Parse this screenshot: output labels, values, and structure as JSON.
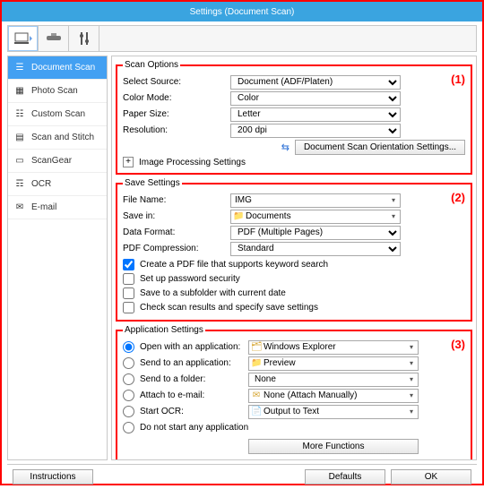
{
  "window": {
    "title": "Settings (Document Scan)"
  },
  "sidebar": {
    "items": [
      {
        "label": "Document Scan"
      },
      {
        "label": "Photo Scan"
      },
      {
        "label": "Custom Scan"
      },
      {
        "label": "Scan and Stitch"
      },
      {
        "label": "ScanGear"
      },
      {
        "label": "OCR"
      },
      {
        "label": "E-mail"
      }
    ]
  },
  "section1": {
    "badge": "(1)",
    "legend": "Scan Options",
    "select_source_label": "Select Source:",
    "select_source_value": "Document (ADF/Platen)",
    "color_mode_label": "Color Mode:",
    "color_mode_value": "Color",
    "paper_size_label": "Paper Size:",
    "paper_size_value": "Letter",
    "resolution_label": "Resolution:",
    "resolution_value": "200 dpi",
    "orient_btn": "Document Scan Orientation Settings...",
    "image_proc": "Image Processing Settings"
  },
  "section2": {
    "badge": "(2)",
    "legend": "Save Settings",
    "file_name_label": "File Name:",
    "file_name_value": "IMG",
    "save_in_label": "Save in:",
    "save_in_value": "Documents",
    "data_format_label": "Data Format:",
    "data_format_value": "PDF (Multiple Pages)",
    "pdf_comp_label": "PDF Compression:",
    "pdf_comp_value": "Standard",
    "chk1": "Create a PDF file that supports keyword search",
    "chk2": "Set up password security",
    "chk3": "Save to a subfolder with current date",
    "chk4": "Check scan results and specify save settings"
  },
  "section3": {
    "badge": "(3)",
    "legend": "Application Settings",
    "r1": "Open with an application:",
    "r1v": "Windows Explorer",
    "r2": "Send to an application:",
    "r2v": "Preview",
    "r3": "Send to a folder:",
    "r3v": "None",
    "r4": "Attach to e-mail:",
    "r4v": "None (Attach Manually)",
    "r5": "Start OCR:",
    "r5v": "Output to Text",
    "r6": "Do not start any application",
    "more": "More Functions"
  },
  "bottom": {
    "instructions": "Instructions",
    "defaults": "Defaults",
    "ok": "OK"
  }
}
